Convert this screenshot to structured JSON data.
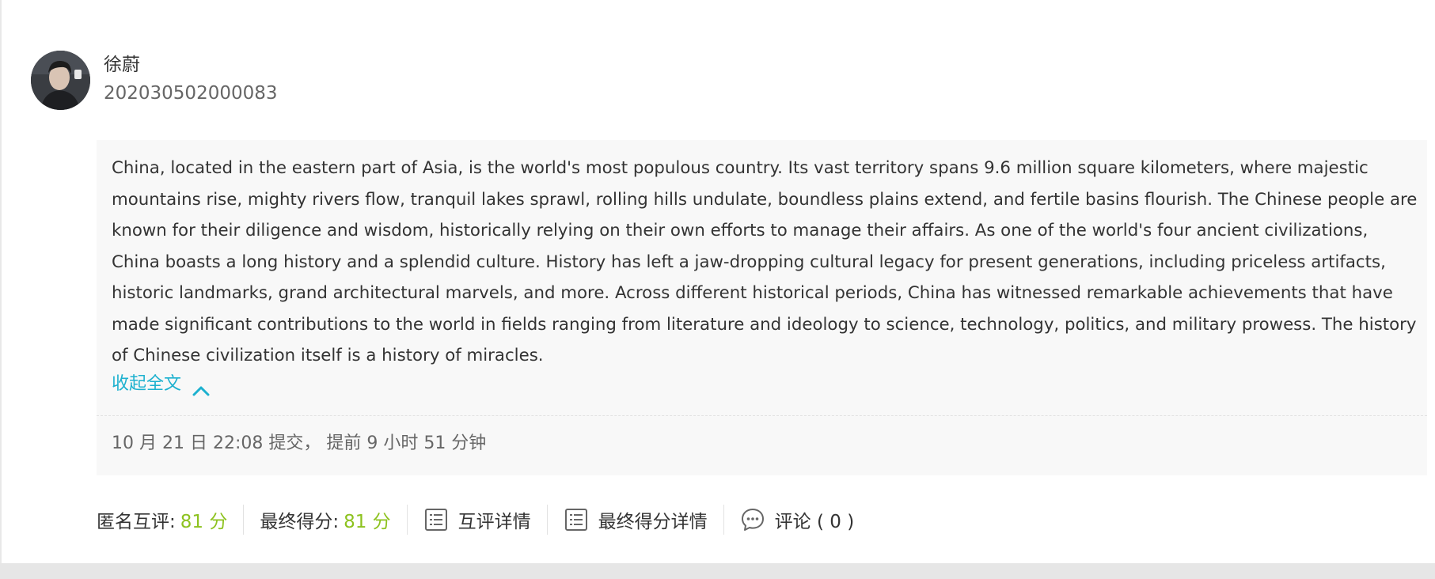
{
  "user": {
    "name": "徐蔚",
    "id": "202030502000083"
  },
  "essay": {
    "text": "China, located in the eastern part of Asia, is the world's most populous country. Its vast territory spans 9.6 million square kilometers, where majestic mountains rise, mighty rivers flow, tranquil lakes sprawl, rolling hills undulate, boundless plains extend, and fertile basins flourish. The Chinese people are known for their diligence and wisdom, historically relying on their own efforts to manage their affairs. As one of the world's four ancient civilizations, China boasts a long history and a splendid culture. History has left a jaw-dropping cultural legacy for present generations, including priceless artifacts, historic landmarks, grand architectural marvels, and more. Across different historical periods, China has witnessed remarkable achievements that have made significant contributions to the world in fields ranging from literature and ideology to science, technology, politics, and military prowess. The history of Chinese civilization itself is a history of miracles.",
    "collapse_label": "收起全文",
    "submit_info": "10 月 21 日 22:08 提交， 提前 9 小时 51 分钟"
  },
  "footer": {
    "anon_review_label": "匿名互评:",
    "anon_review_score": "81 分",
    "final_score_label": "最终得分:",
    "final_score_value": "81 分",
    "peer_review_details": "互评详情",
    "final_score_details": "最终得分详情",
    "comments_label": "评论 ( 0 )"
  },
  "icons": {
    "collapse": "chevron-up-icon",
    "peer_review": "list-icon",
    "final_score": "list-icon",
    "comments": "comment-icon"
  },
  "colors": {
    "accent_link": "#1db1cf",
    "score": "#8dc21f",
    "text": "#333333",
    "muted": "#666666",
    "panel_bg": "#f8f8f8"
  }
}
